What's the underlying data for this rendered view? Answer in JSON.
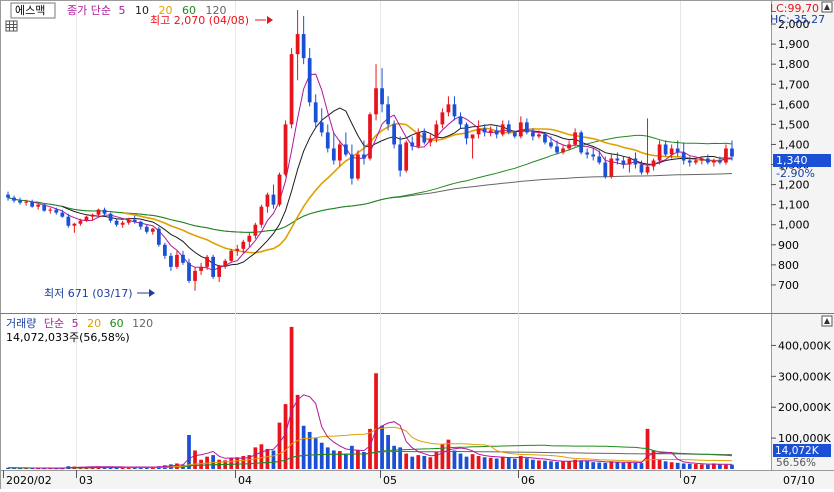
{
  "price_panel": {
    "stock_name": "에스맥",
    "ma_label": "종가 단순",
    "ma_periods": [
      "5",
      "10",
      "20",
      "60",
      "120"
    ],
    "lc_label": "LC:99,70",
    "hc_label": "HC:-35,27",
    "high_label": "최고 2,070 (04/08)",
    "low_label": "최저 671 (03/17)",
    "current_price": "1,340",
    "change_pct": "-2.90%"
  },
  "volume_panel": {
    "title": "거래량",
    "ma_label": "단순",
    "ma_periods": [
      "5",
      "20",
      "60",
      "120"
    ],
    "info": "14,072,033주(56,58%)",
    "current_volume": "14,072K",
    "current_pct": "56.56%"
  },
  "colors": {
    "up": "#e8141b",
    "down": "#1a4fd6",
    "ma5": "#b0189a",
    "ma10": "#1c1c1c",
    "ma20": "#e0a000",
    "ma60": "#1e8a1e",
    "ma120": "#666666"
  },
  "chart_data": [
    {
      "type": "candlestick",
      "title": "에스맥",
      "ylim": [
        600,
        2070
      ],
      "y_ticks": [
        "700",
        "800",
        "900",
        "1,000",
        "1,100",
        "1,200",
        "1,300",
        "1,400",
        "1,500",
        "1,600",
        "1,700",
        "1,800",
        "1,900",
        "2,000"
      ],
      "x_ticks": [
        "2020/02",
        "03",
        "04",
        "05",
        "06",
        "07",
        "07/10"
      ],
      "candles": [
        [
          1150,
          1165,
          1120,
          1135
        ],
        [
          1135,
          1145,
          1110,
          1120
        ],
        [
          1120,
          1135,
          1100,
          1110
        ],
        [
          1110,
          1125,
          1095,
          1115
        ],
        [
          1115,
          1125,
          1085,
          1090
        ],
        [
          1090,
          1105,
          1075,
          1100
        ],
        [
          1100,
          1105,
          1065,
          1070
        ],
        [
          1070,
          1085,
          1055,
          1075
        ],
        [
          1075,
          1085,
          1050,
          1060
        ],
        [
          1060,
          1075,
          1035,
          1040
        ],
        [
          1040,
          1055,
          985,
          995
        ],
        [
          995,
          1010,
          960,
          1005
        ],
        [
          1005,
          1030,
          995,
          1020
        ],
        [
          1020,
          1045,
          1015,
          1040
        ],
        [
          1040,
          1055,
          1020,
          1050
        ],
        [
          1050,
          1080,
          1040,
          1075
        ],
        [
          1075,
          1085,
          1045,
          1055
        ],
        [
          1055,
          1060,
          1010,
          1020
        ],
        [
          1020,
          1030,
          990,
          1000
        ],
        [
          1000,
          1020,
          985,
          1010
        ],
        [
          1010,
          1035,
          1000,
          1025
        ],
        [
          1025,
          1045,
          1005,
          1015
        ],
        [
          1015,
          1020,
          975,
          990
        ],
        [
          990,
          1000,
          955,
          965
        ],
        [
          965,
          985,
          950,
          980
        ],
        [
          980,
          990,
          890,
          900
        ],
        [
          900,
          910,
          830,
          845
        ],
        [
          845,
          860,
          770,
          790
        ],
        [
          790,
          870,
          780,
          850
        ],
        [
          850,
          870,
          800,
          810
        ],
        [
          810,
          830,
          710,
          720
        ],
        [
          720,
          790,
          671,
          770
        ],
        [
          770,
          810,
          750,
          790
        ],
        [
          790,
          850,
          775,
          840
        ],
        [
          840,
          850,
          730,
          740
        ],
        [
          740,
          800,
          715,
          795
        ],
        [
          795,
          830,
          780,
          820
        ],
        [
          820,
          880,
          815,
          870
        ],
        [
          870,
          900,
          845,
          880
        ],
        [
          880,
          925,
          860,
          915
        ],
        [
          915,
          960,
          890,
          945
        ],
        [
          945,
          1010,
          930,
          1000
        ],
        [
          1000,
          1100,
          985,
          1090
        ],
        [
          1090,
          1160,
          1060,
          1150
        ],
        [
          1150,
          1200,
          1080,
          1100
        ],
        [
          1100,
          1260,
          1090,
          1250
        ],
        [
          1250,
          1520,
          1240,
          1500
        ],
        [
          1500,
          1880,
          1480,
          1850
        ],
        [
          1850,
          2070,
          1720,
          1950
        ],
        [
          1950,
          2040,
          1800,
          1830
        ],
        [
          1830,
          1880,
          1590,
          1610
        ],
        [
          1610,
          1650,
          1480,
          1510
        ],
        [
          1510,
          1580,
          1440,
          1460
        ],
        [
          1460,
          1500,
          1360,
          1380
        ],
        [
          1380,
          1460,
          1300,
          1320
        ],
        [
          1320,
          1420,
          1290,
          1400
        ],
        [
          1400,
          1460,
          1340,
          1350
        ],
        [
          1350,
          1400,
          1200,
          1230
        ],
        [
          1230,
          1370,
          1220,
          1350
        ],
        [
          1350,
          1420,
          1300,
          1330
        ],
        [
          1330,
          1560,
          1320,
          1550
        ],
        [
          1550,
          1800,
          1520,
          1680
        ],
        [
          1680,
          1780,
          1560,
          1600
        ],
        [
          1600,
          1640,
          1470,
          1500
        ],
        [
          1500,
          1520,
          1380,
          1400
        ],
        [
          1400,
          1440,
          1240,
          1270
        ],
        [
          1270,
          1420,
          1260,
          1410
        ],
        [
          1410,
          1440,
          1370,
          1390
        ],
        [
          1390,
          1480,
          1380,
          1460
        ],
        [
          1460,
          1480,
          1400,
          1410
        ],
        [
          1410,
          1450,
          1390,
          1430
        ],
        [
          1430,
          1520,
          1410,
          1500
        ],
        [
          1500,
          1580,
          1480,
          1560
        ],
        [
          1560,
          1640,
          1540,
          1600
        ],
        [
          1600,
          1640,
          1520,
          1540
        ],
        [
          1540,
          1560,
          1480,
          1500
        ],
        [
          1500,
          1510,
          1400,
          1430
        ],
        [
          1430,
          1440,
          1330,
          1450
        ],
        [
          1450,
          1520,
          1430,
          1480
        ],
        [
          1480,
          1500,
          1440,
          1460
        ],
        [
          1460,
          1490,
          1440,
          1470
        ],
        [
          1470,
          1490,
          1430,
          1450
        ],
        [
          1450,
          1520,
          1440,
          1500
        ],
        [
          1500,
          1520,
          1450,
          1460
        ],
        [
          1460,
          1470,
          1430,
          1440
        ],
        [
          1440,
          1540,
          1430,
          1510
        ],
        [
          1510,
          1530,
          1450,
          1460
        ],
        [
          1460,
          1480,
          1420,
          1440
        ],
        [
          1440,
          1470,
          1430,
          1450
        ],
        [
          1450,
          1460,
          1400,
          1410
        ],
        [
          1410,
          1440,
          1380,
          1390
        ],
        [
          1390,
          1420,
          1350,
          1360
        ],
        [
          1360,
          1400,
          1350,
          1380
        ],
        [
          1380,
          1420,
          1370,
          1400
        ],
        [
          1400,
          1480,
          1390,
          1460
        ],
        [
          1460,
          1470,
          1350,
          1360
        ],
        [
          1360,
          1380,
          1330,
          1350
        ],
        [
          1350,
          1380,
          1320,
          1340
        ],
        [
          1340,
          1370,
          1300,
          1310
        ],
        [
          1310,
          1340,
          1230,
          1240
        ],
        [
          1240,
          1350,
          1230,
          1330
        ],
        [
          1330,
          1360,
          1300,
          1320
        ],
        [
          1320,
          1340,
          1280,
          1300
        ],
        [
          1300,
          1340,
          1260,
          1330
        ],
        [
          1330,
          1360,
          1280,
          1300
        ],
        [
          1300,
          1320,
          1250,
          1260
        ],
        [
          1260,
          1530,
          1250,
          1290
        ],
        [
          1290,
          1330,
          1270,
          1320
        ],
        [
          1320,
          1420,
          1300,
          1400
        ],
        [
          1400,
          1420,
          1340,
          1350
        ],
        [
          1350,
          1400,
          1330,
          1380
        ],
        [
          1380,
          1420,
          1340,
          1360
        ],
        [
          1360,
          1410,
          1300,
          1320
        ],
        [
          1320,
          1340,
          1290,
          1310
        ],
        [
          1310,
          1330,
          1300,
          1320
        ],
        [
          1320,
          1340,
          1300,
          1330
        ],
        [
          1330,
          1350,
          1300,
          1310
        ],
        [
          1310,
          1330,
          1290,
          1320
        ],
        [
          1320,
          1340,
          1300,
          1310
        ],
        [
          1310,
          1400,
          1300,
          1380
        ],
        [
          1380,
          1420,
          1320,
          1340
        ]
      ]
    },
    {
      "type": "bar",
      "title": "거래량",
      "ylim": [
        0,
        450000
      ],
      "y_ticks": [
        "100,000K",
        "200,000K",
        "300,000K",
        "400,000K"
      ],
      "values": [
        4000,
        3500,
        3000,
        3200,
        3100,
        2800,
        2700,
        2900,
        2600,
        2500,
        9000,
        8000,
        7000,
        6500,
        7200,
        8800,
        6400,
        6000,
        5800,
        6300,
        7000,
        6600,
        6200,
        6800,
        6000,
        9000,
        12000,
        15000,
        18000,
        14000,
        110000,
        60000,
        30000,
        40000,
        45000,
        30000,
        28000,
        35000,
        38000,
        42000,
        45000,
        70000,
        80000,
        65000,
        60000,
        150000,
        210000,
        460000,
        240000,
        140000,
        120000,
        100000,
        85000,
        70000,
        60000,
        58000,
        50000,
        75000,
        62000,
        55000,
        130000,
        310000,
        140000,
        110000,
        75000,
        70000,
        50000,
        40000,
        45000,
        42000,
        38000,
        55000,
        80000,
        95000,
        60000,
        50000,
        40000,
        48000,
        42000,
        38000,
        36000,
        34000,
        40000,
        38000,
        33000,
        42000,
        35000,
        30000,
        28000,
        27000,
        25000,
        23000,
        24000,
        26000,
        30000,
        28000,
        25000,
        22000,
        21000,
        20000,
        25000,
        23000,
        20000,
        22000,
        20000,
        19000,
        130000,
        60000,
        30000,
        25000,
        22000,
        20000,
        18000,
        17000,
        16000,
        15000,
        14000,
        18000,
        15000,
        14000,
        14072
      ]
    }
  ]
}
